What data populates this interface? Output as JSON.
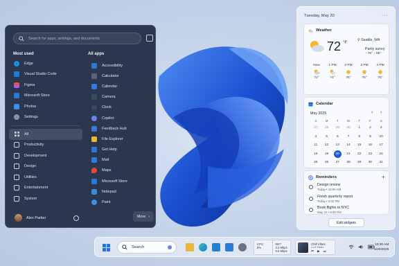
{
  "start_menu": {
    "search_placeholder": "Search for apps, settings, and documents",
    "most_used_heading": "Most used",
    "most_used": [
      {
        "label": "Edge",
        "icon": "edge-icon",
        "color": "#1f8ad8"
      },
      {
        "label": "Visual Studio Code",
        "icon": "vscode-icon",
        "color": "#1b7fd0"
      },
      {
        "label": "Figma",
        "icon": "figma-icon",
        "color": "#e4553c"
      },
      {
        "label": "Microsoft Store",
        "icon": "store-icon",
        "color": "#2d7ad6"
      },
      {
        "label": "Photos",
        "icon": "photos-icon",
        "color": "#3e8de0"
      },
      {
        "label": "Settings",
        "icon": "gear-icon",
        "color": "#8a93a6"
      }
    ],
    "folders": [
      {
        "label": "All",
        "icon": "grid-icon"
      },
      {
        "label": "Productivity",
        "icon": "folder-icon"
      },
      {
        "label": "Development",
        "icon": "folder-icon"
      },
      {
        "label": "Design",
        "icon": "folder-icon"
      },
      {
        "label": "Utilities",
        "icon": "folder-icon"
      },
      {
        "label": "Entertainment",
        "icon": "folder-icon"
      },
      {
        "label": "System",
        "icon": "folder-icon"
      }
    ],
    "all_apps_heading": "All apps",
    "all_apps": [
      {
        "label": "Accessibility",
        "icon": "accessibility-icon",
        "color": "#2d7ad6"
      },
      {
        "label": "Calculator",
        "icon": "calculator-icon",
        "color": "#5b6577"
      },
      {
        "label": "Calendar",
        "icon": "calendar-icon",
        "color": "#2f7de0"
      },
      {
        "label": "Camera",
        "icon": "camera-icon",
        "color": "#3a4a63"
      },
      {
        "label": "Clock",
        "icon": "clock-icon",
        "color": "#3a4a63"
      },
      {
        "label": "Copilot",
        "icon": "copilot-icon",
        "color": "#3ea7e8"
      },
      {
        "label": "Feedback Hub",
        "icon": "feedback-icon",
        "color": "#3d7bd3"
      },
      {
        "label": "File Explorer",
        "icon": "file-explorer-icon",
        "color": "#e8b93a"
      },
      {
        "label": "Get Help",
        "icon": "help-icon",
        "color": "#2d7ad6"
      },
      {
        "label": "Mail",
        "icon": "mail-icon",
        "color": "#2f7de0"
      },
      {
        "label": "Maps",
        "icon": "maps-icon",
        "color": "#e2483d"
      },
      {
        "label": "Microsoft Store",
        "icon": "store-icon",
        "color": "#2d7ad6"
      },
      {
        "label": "Notepad",
        "icon": "notepad-icon",
        "color": "#3d88d8"
      },
      {
        "label": "Paint",
        "icon": "paint-icon",
        "color": "#3b8ee0"
      }
    ],
    "user_name": "Alex Parker",
    "more_label": "More"
  },
  "widgets": {
    "date": "Tuesday, May 20",
    "weather": {
      "title": "Weather",
      "location": "Seattle, WA",
      "temp": "72",
      "unit": "°F",
      "condition": "Partly sunny",
      "hilo": "↑ 76°  ↓ 58°",
      "hourly": [
        {
          "time": "Now",
          "temp": "72°",
          "icon": "partly-sunny-icon"
        },
        {
          "time": "1 PM",
          "temp": "74°",
          "icon": "sun-icon"
        },
        {
          "time": "2 PM",
          "temp": "75°",
          "icon": "sun-icon"
        },
        {
          "time": "3 PM",
          "temp": "76°",
          "icon": "sun-icon"
        },
        {
          "time": "4 PM",
          "temp": "75°",
          "icon": "sun-icon"
        }
      ]
    },
    "calendar": {
      "title": "Calendar",
      "month": "May 2025",
      "weekdays": [
        "S",
        "M",
        "T",
        "W",
        "T",
        "F",
        "S"
      ],
      "days": [
        [
          "27",
          "28",
          "29",
          "30",
          "1",
          "2",
          "3"
        ],
        [
          "4",
          "5",
          "6",
          "7",
          "8",
          "9",
          "10"
        ],
        [
          "11",
          "12",
          "13",
          "14",
          "15",
          "16",
          "17"
        ],
        [
          "18",
          "19",
          "20",
          "21",
          "22",
          "23",
          "24"
        ],
        [
          "25",
          "26",
          "27",
          "28",
          "29",
          "30",
          "31"
        ]
      ],
      "today": "20"
    },
    "reminders": {
      "title": "Reminders",
      "items": [
        {
          "title": "Design review",
          "sub": "Today • 10:00 AM"
        },
        {
          "title": "Finish quarterly report",
          "sub": "Today • 3:00 PM"
        },
        {
          "title": "Book flights to NYC",
          "sub": "May 22 • 8:00 PM"
        }
      ]
    },
    "edit_label": "Edit widgets"
  },
  "taskbar": {
    "search_label": "Search",
    "perf": [
      {
        "label": "CPU",
        "value": "8%"
      },
      {
        "label": "NET",
        "value": "3.2 Mbps",
        "extra": "0.5 Mbps"
      }
    ],
    "media": {
      "title": "Chill Vibes",
      "subtitle": "Lo-fi Radio"
    },
    "time": "10:30 AM",
    "date": "5/20/2025"
  }
}
